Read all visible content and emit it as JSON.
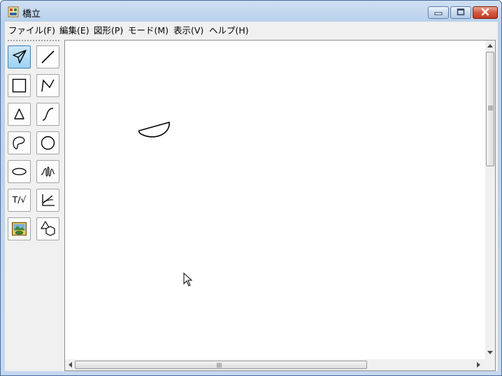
{
  "window": {
    "title": "橋立",
    "app_icon": "app-logo-icon",
    "buttons": {
      "minimize_icon": "minimize-icon",
      "maximize_icon": "maximize-icon",
      "close_icon": "close-icon"
    }
  },
  "menu": {
    "items": [
      {
        "label": "ファイル(F)"
      },
      {
        "label": "編集(E)"
      },
      {
        "label": "図形(P)"
      },
      {
        "label": "モード(M)"
      },
      {
        "label": "表示(V)"
      },
      {
        "label": "ヘルプ(H)"
      }
    ]
  },
  "toolbox": {
    "tools": [
      {
        "icon": "select-arrow-icon",
        "selected": true
      },
      {
        "icon": "line-icon"
      },
      {
        "icon": "rectangle-icon"
      },
      {
        "icon": "polyline-icon"
      },
      {
        "icon": "triangle-icon"
      },
      {
        "icon": "curve-icon"
      },
      {
        "icon": "freeform-icon"
      },
      {
        "icon": "circle-icon"
      },
      {
        "icon": "ellipse-icon"
      },
      {
        "icon": "spring-icon"
      },
      {
        "label": "T/√",
        "icon": "text-formula-icon"
      },
      {
        "icon": "graph-icon"
      },
      {
        "icon": "image-icon"
      },
      {
        "icon": "shapes-icon"
      }
    ]
  },
  "canvas": {
    "shapes": [
      {
        "type": "semicircle"
      }
    ]
  },
  "colors": {
    "accent": "#3c7fb1",
    "close_button": "#c23c22"
  }
}
